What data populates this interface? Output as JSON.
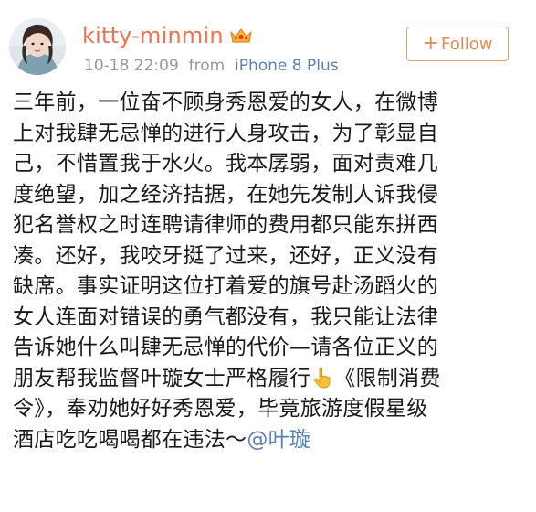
{
  "post": {
    "author": {
      "username": "kitty-minmin",
      "avatar_icon": "avatar",
      "badge_icon": "crown-icon"
    },
    "timestamp": "10-18 22:09",
    "source_prefix": "from",
    "source_device": "iPhone 8 Plus",
    "follow_label": "Follow",
    "follow_plus": "+",
    "content_lines": [
      "三年前，一位奋不顾身秀恩爱的女人，在微博",
      "上对我肆无忌惮的进行人身攻击，为了彰显自",
      "己，不惜置我于水火。我本孱弱，面对责难几",
      "度绝望，加之经济拮据，在她先发制人诉我侵",
      "犯名誉权之时连聘请律师的费用都只能东拼西",
      "凑。还好，我咬牙挺了过来，还好，正义没有",
      "缺席。事实证明这位打着爱的旗号赴汤蹈火的",
      "女人连面对错误的勇气都没有，我只能让法律",
      "告诉她什么叫肆无忌惮的代价—请各位正义的"
    ],
    "line_10_before_icon": "朋友帮我监督叶璇女士严格履行",
    "line_10_after_icon": "《限制消费",
    "line_11": "令》，奉劝她好好秀恩爱，毕竟旅游度假星级",
    "line_12_text": "酒店吃吃喝喝都在违法～",
    "mention": "@叶璇",
    "hand_icon": "pointing-down-hand-icon"
  },
  "colors": {
    "username": "#eb7350",
    "meta": "#999999",
    "link": "#5a7fb5",
    "follow_border": "#e3a172",
    "follow_text": "#e58a4e",
    "text": "#1a1a1a"
  }
}
